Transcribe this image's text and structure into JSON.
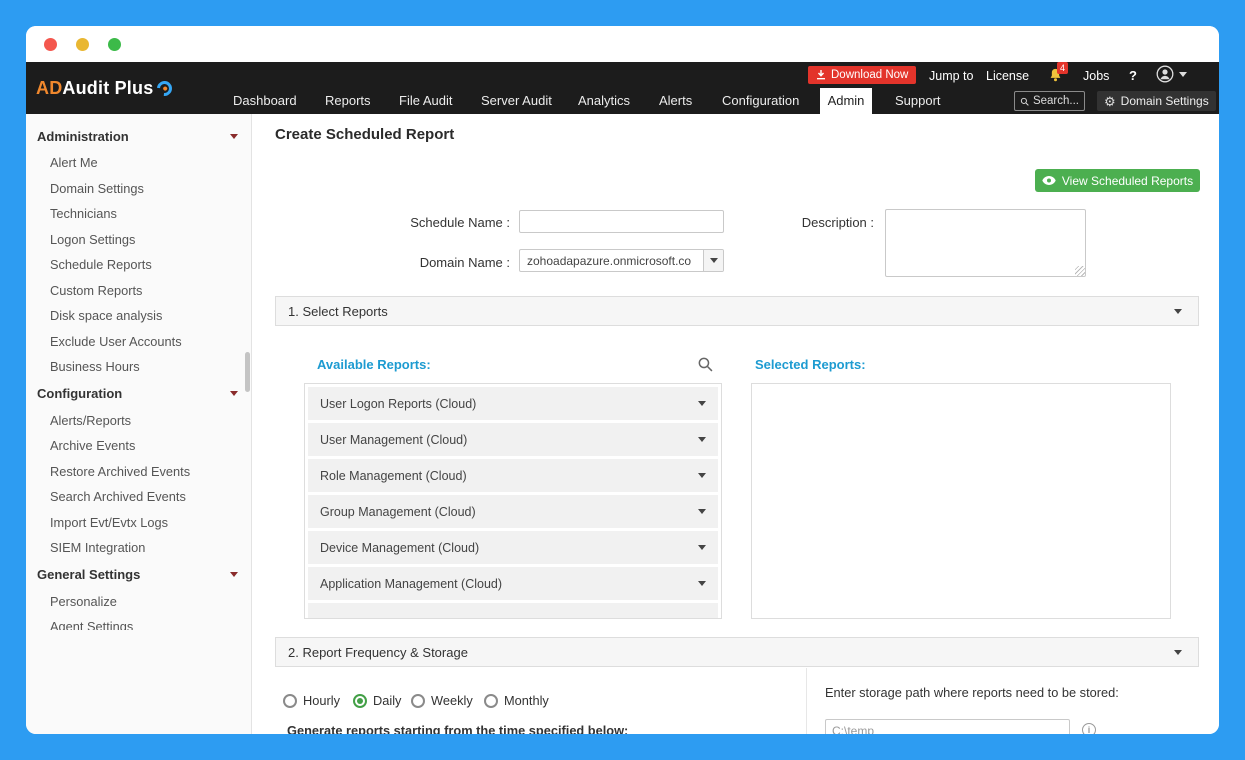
{
  "colors": {
    "frame_blue": "#2d9cf2",
    "header_black": "#1c1c1c",
    "accent_red": "#e3342b",
    "accent_green": "#4caf50",
    "link_teal": "#1d9bd1",
    "logo_orange": "#f0882d"
  },
  "header": {
    "logo": {
      "prefix": "AD",
      "suffix": "Audit Plus"
    },
    "actions": {
      "download": "Download Now",
      "jump_to": "Jump to",
      "license": "License",
      "notifications_badge": "4",
      "jobs": "Jobs",
      "help": "?"
    },
    "nav": [
      {
        "label": "Dashboard"
      },
      {
        "label": "Reports"
      },
      {
        "label": "File Audit"
      },
      {
        "label": "Server Audit"
      },
      {
        "label": "Analytics"
      },
      {
        "label": "Alerts"
      },
      {
        "label": "Configuration"
      },
      {
        "label": "Admin",
        "active": true
      },
      {
        "label": "Support"
      }
    ],
    "search_placeholder": "Search...",
    "domain_settings_label": "Domain Settings"
  },
  "sidebar": {
    "sections": [
      {
        "title": "Administration",
        "items": [
          "Alert Me",
          "Domain Settings",
          "Technicians",
          "Logon Settings",
          "Schedule Reports",
          "Custom Reports",
          "Disk space analysis",
          "Exclude User Accounts",
          "Business Hours"
        ]
      },
      {
        "title": "Configuration",
        "items": [
          "Alerts/Reports",
          "Archive Events",
          "Restore Archived Events",
          "Search Archived Events",
          "Import Evt/Evtx Logs",
          "SIEM Integration"
        ]
      },
      {
        "title": "General Settings",
        "items": [
          "Personalize",
          "Agent Settings"
        ]
      }
    ]
  },
  "main": {
    "title": "Create Scheduled Report",
    "view_scheduled_label": "View Scheduled Reports",
    "form": {
      "schedule_name_label": "Schedule Name :",
      "schedule_name_value": "",
      "domain_name_label": "Domain Name :",
      "domain_value": "zohoadapazure.onmicrosoft.co",
      "description_label": "Description :",
      "description_value": ""
    },
    "section1": {
      "title": "1. Select Reports",
      "available_label": "Available Reports:",
      "selected_label": "Selected Reports:",
      "available_items": [
        "User Logon Reports (Cloud)",
        "User Management (Cloud)",
        "Role Management (Cloud)",
        "Group Management (Cloud)",
        "Device Management (Cloud)",
        "Application Management (Cloud)"
      ]
    },
    "section2": {
      "title": "2. Report Frequency & Storage",
      "frequencies": [
        "Hourly",
        "Daily",
        "Weekly",
        "Monthly"
      ],
      "selected_frequency": "Daily",
      "generate_text": "Generate reports starting from the time specified below:",
      "storage_label": "Enter storage path where reports need to be stored:",
      "storage_value": "C:\\temp"
    }
  }
}
